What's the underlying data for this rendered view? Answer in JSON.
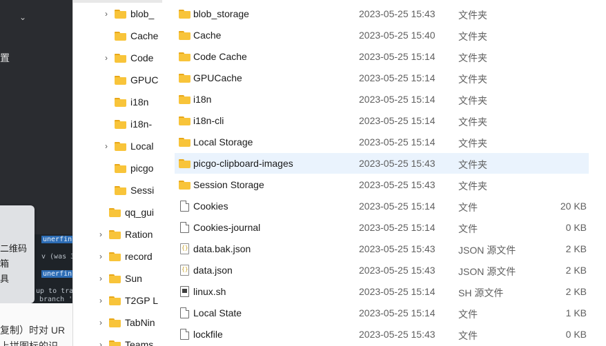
{
  "background_app": {
    "top_glyph": "置",
    "menu_items": [
      "二维码",
      "箱",
      "具"
    ],
    "terminal": {
      "line1": "unerfinn/",
      "line2": "v (was 32",
      "line3": "unerfinn/",
      "line4": "up to tra",
      "line5": "branch '"
    },
    "text_line1": "复制）时对 UR",
    "text_line2": "上拼图标的识"
  },
  "nav": {
    "items": [
      {
        "label": "blob_",
        "expandable": true
      },
      {
        "label": "Cache",
        "expandable": false
      },
      {
        "label": "Code",
        "expandable": true
      },
      {
        "label": "GPUC",
        "expandable": false
      },
      {
        "label": "i18n",
        "expandable": false
      },
      {
        "label": "i18n-",
        "expandable": false
      },
      {
        "label": "Local",
        "expandable": true
      },
      {
        "label": "picgo",
        "expandable": false
      },
      {
        "label": "Sessi",
        "expandable": false
      },
      {
        "label": "qq_gui",
        "expandable": false
      },
      {
        "label": "Ration",
        "expandable": true
      },
      {
        "label": "record",
        "expandable": true
      },
      {
        "label": "Sun",
        "expandable": true
      },
      {
        "label": "T2GP L",
        "expandable": true
      },
      {
        "label": "TabNin",
        "expandable": true
      },
      {
        "label": "Teams",
        "expandable": true
      }
    ]
  },
  "files": [
    {
      "name": "blob_storage",
      "date": "2023-05-25 15:43",
      "type": "文件夹",
      "size": "",
      "icon": "folder"
    },
    {
      "name": "Cache",
      "date": "2023-05-25 15:40",
      "type": "文件夹",
      "size": "",
      "icon": "folder"
    },
    {
      "name": "Code Cache",
      "date": "2023-05-25 15:14",
      "type": "文件夹",
      "size": "",
      "icon": "folder"
    },
    {
      "name": "GPUCache",
      "date": "2023-05-25 15:14",
      "type": "文件夹",
      "size": "",
      "icon": "folder"
    },
    {
      "name": "i18n",
      "date": "2023-05-25 15:14",
      "type": "文件夹",
      "size": "",
      "icon": "folder"
    },
    {
      "name": "i18n-cli",
      "date": "2023-05-25 15:14",
      "type": "文件夹",
      "size": "",
      "icon": "folder"
    },
    {
      "name": "Local Storage",
      "date": "2023-05-25 15:14",
      "type": "文件夹",
      "size": "",
      "icon": "folder"
    },
    {
      "name": "picgo-clipboard-images",
      "date": "2023-05-25 15:43",
      "type": "文件夹",
      "size": "",
      "icon": "folder",
      "selected": true
    },
    {
      "name": "Session Storage",
      "date": "2023-05-25 15:43",
      "type": "文件夹",
      "size": "",
      "icon": "folder"
    },
    {
      "name": "Cookies",
      "date": "2023-05-25 15:14",
      "type": "文件",
      "size": "20 KB",
      "icon": "file"
    },
    {
      "name": "Cookies-journal",
      "date": "2023-05-25 15:14",
      "type": "文件",
      "size": "0 KB",
      "icon": "file"
    },
    {
      "name": "data.bak.json",
      "date": "2023-05-25 15:43",
      "type": "JSON 源文件",
      "size": "2 KB",
      "icon": "json"
    },
    {
      "name": "data.json",
      "date": "2023-05-25 15:43",
      "type": "JSON 源文件",
      "size": "2 KB",
      "icon": "json"
    },
    {
      "name": "linux.sh",
      "date": "2023-05-25 15:14",
      "type": "SH 源文件",
      "size": "2 KB",
      "icon": "sh"
    },
    {
      "name": "Local State",
      "date": "2023-05-25 15:14",
      "type": "文件",
      "size": "1 KB",
      "icon": "file"
    },
    {
      "name": "lockfile",
      "date": "2023-05-25 15:43",
      "type": "文件",
      "size": "0 KB",
      "icon": "file"
    }
  ]
}
